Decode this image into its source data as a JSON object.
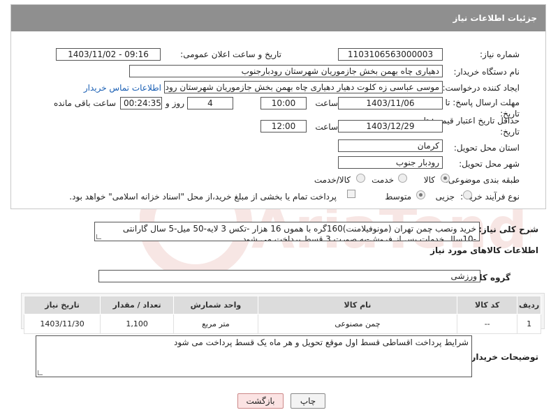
{
  "header": {
    "title": "جزئیات اطلاعات نیاز"
  },
  "form": {
    "need_number_label": "شماره نیاز:",
    "need_number": "1103106563000003",
    "announce_label": "تاریخ و ساعت اعلان عمومی:",
    "announce_value": "1403/11/02 - 09:16",
    "buyer_org_label": "نام دستگاه خریدار:",
    "buyer_org": "دهیاری چاه بهمن بخش جازموریان شهرستان رودبارجنوب",
    "creator_label": "ایجاد کننده درخواست:",
    "creator": "موسی عباسی زه کلوت دهیار دهیاری چاه بهمن بخش جازموریان شهرستان رود",
    "contact_link": "اطلاعات تماس خریدار",
    "deadline_label": "مهلت ارسال پاسخ: تا تاریخ:",
    "deadline_date": "1403/11/06",
    "time_label": "ساعت",
    "deadline_time": "10:00",
    "days_value": "4",
    "days_label": "روز و",
    "remaining_time": "00:24:35",
    "remaining_label": "ساعت باقی مانده",
    "validity_label": "حداقل تاریخ اعتبار قیمت: تا تاریخ:",
    "validity_date": "1403/12/29",
    "validity_time": "12:00",
    "province_label": "استان محل تحویل:",
    "province": "کرمان",
    "city_label": "شهر محل تحویل:",
    "city": "رودبار جنوب",
    "category_label": "طبقه بندی موضوعی:",
    "category_options": [
      "کالا",
      "خدمت",
      "کالا/خدمت"
    ],
    "process_label": "نوع فرآیند خرید :",
    "process_options": [
      "جزیی",
      "متوسط"
    ],
    "payment_note": "پرداخت تمام یا بخشی از مبلغ خرید،از محل \"اسناد خزانه اسلامی\" خواهد بود."
  },
  "description": {
    "label": "شرح کلی نیاز:",
    "text": "خرید ونصب چمن تهران (مونوفیلامنت)160گره با هموں 16 هزار -تکس 3 لایه-50 میل-5 سال گارانتی -10سال خدمات پس از فروش-به صورت 3 قسط پرداخت می شود"
  },
  "goods": {
    "section_title": "اطلاعات کالاهای مورد نیاز",
    "group_label": "گروه کالا:",
    "group_value": "ورزشی",
    "columns": [
      "ردیف",
      "کد کالا",
      "نام کالا",
      "واحد شمارش",
      "تعداد / مقدار",
      "تاریخ نیاز"
    ],
    "rows": [
      [
        "1",
        "--",
        "چمن مصنوعی",
        "متر مربع",
        "1,100",
        "1403/11/30"
      ]
    ]
  },
  "buyer_notes": {
    "label": "توضیحات خریدار:",
    "text": "شرایط پرداخت اقساطی  قسط اول موقع تحویل و هر ماه یک قسط پرداخت می شود"
  },
  "buttons": {
    "print": "چاپ",
    "back": "بازگشت"
  },
  "watermark": {
    "text": "AriaTender.neT"
  },
  "colors": {
    "header_bg": "#8f8f8f",
    "link": "#1a5fb4",
    "back_button_bg": "#fbe3e3"
  }
}
